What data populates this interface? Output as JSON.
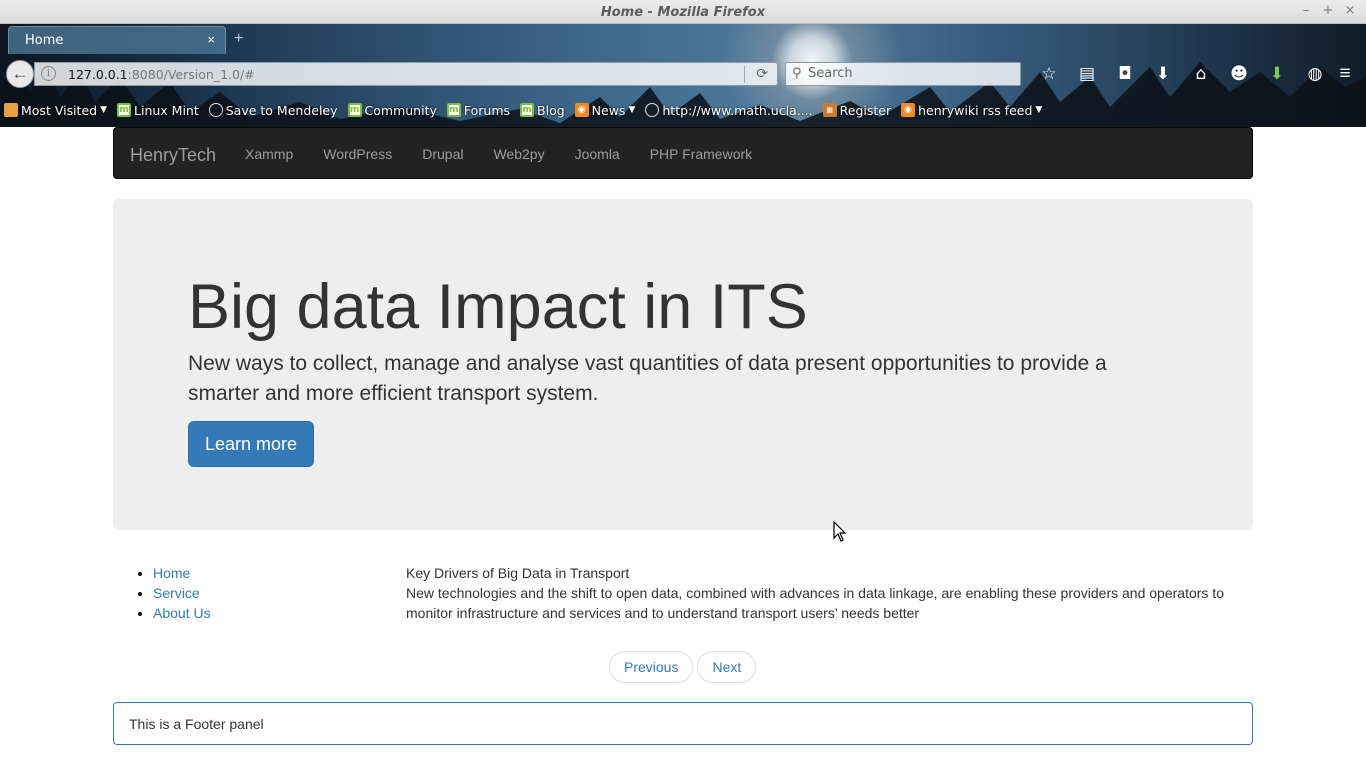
{
  "window": {
    "title": "Home - Mozilla Firefox",
    "buttons": [
      "–",
      "+",
      "×"
    ]
  },
  "tab": {
    "title": "Home",
    "close": "×",
    "new_tab": "+"
  },
  "navbar_toolbar": {
    "url_host": "127.0.0.1",
    "url_path": ":8080/Version_1.0/#",
    "search_placeholder": "Search"
  },
  "toolbar_icons": [
    "star-icon",
    "reading-list-icon",
    "pocket-icon",
    "download-icon",
    "home-icon",
    "smiley-icon",
    "green-arrow-icon",
    "globe-icon",
    "menu-icon"
  ],
  "bookmarks": [
    {
      "label": "Most Visited",
      "icon": "folder",
      "caret": true
    },
    {
      "label": "Linux Mint",
      "icon": "mint"
    },
    {
      "label": "Save to Mendeley",
      "icon": "globe"
    },
    {
      "label": "Community",
      "icon": "mint"
    },
    {
      "label": "Forums",
      "icon": "mint"
    },
    {
      "label": "Blog",
      "icon": "mint"
    },
    {
      "label": "News",
      "icon": "rss",
      "caret": true
    },
    {
      "label": "http://www.math.ucla....",
      "icon": "globe"
    },
    {
      "label": "Register",
      "icon": "app"
    },
    {
      "label": "henrywiki rss feed",
      "icon": "rss",
      "caret": true
    }
  ],
  "site": {
    "brand": "HenryTech",
    "nav": [
      "Xammp",
      "WordPress",
      "Drupal",
      "Web2py",
      "Joomla",
      "PHP Framework"
    ]
  },
  "jumbotron": {
    "heading": "Big data Impact in ITS",
    "lead": "New ways to collect, manage and analyse vast quantities of data present opportunities to provide a smarter and more efficient transport system.",
    "button": "Learn more"
  },
  "sidebar": {
    "links": [
      "Home",
      "Service",
      "About Us"
    ]
  },
  "content": {
    "title": "Key Drivers of Big Data in Transport",
    "body": "New technologies and the shift to open data, combined with advances in data linkage, are enabling these providers and operators to monitor infrastructure and services and to understand transport users’ needs better"
  },
  "pager": {
    "previous": "Previous",
    "next": "Next"
  },
  "footer": {
    "text": "This is a Footer panel"
  },
  "colors": {
    "primary": "#337ab7",
    "navbar": "#222222",
    "jumbotron": "#eeeeee"
  }
}
